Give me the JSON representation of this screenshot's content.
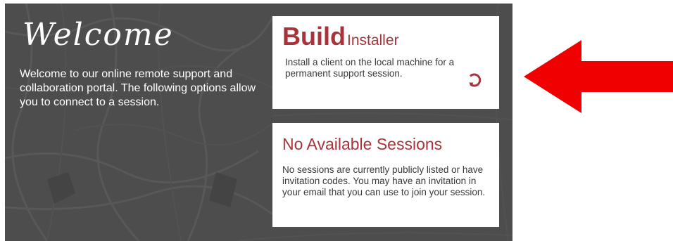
{
  "welcome": {
    "title": "Welcome",
    "text": "Welcome to our online remote support and collaboration portal. The following options allow you to connect to a session."
  },
  "build_card": {
    "title_strong": "Build",
    "title_light": "Installer",
    "description": "Install a client on the local machine for a permanent support session.",
    "arrow_icon": "circular-arrow-icon"
  },
  "sessions_card": {
    "title": "No Available Sessions",
    "description": "No sessions are currently publicly listed or have invitation codes. You may have an invitation in your email that you can use to join your session."
  },
  "annotation": {
    "arrow_icon": "red-arrow-icon",
    "color": "#f00000"
  },
  "colors": {
    "panel_background": "#4d4d4d",
    "accent": "#a8333a",
    "card_background": "#ffffff",
    "body_text": "#3a3a3a"
  }
}
